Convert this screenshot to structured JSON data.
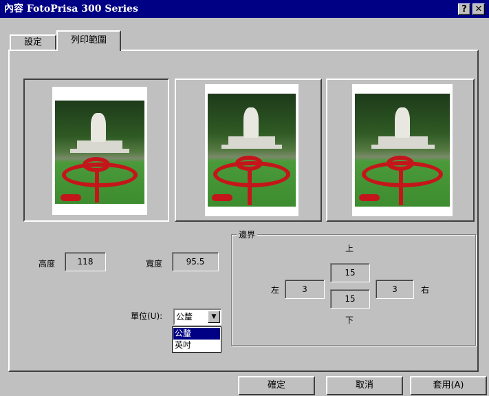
{
  "window": {
    "title": "內容 FotoPrisa 300 Series",
    "help_glyph": "?",
    "close_glyph": "✕"
  },
  "tabs": [
    {
      "label": "設定"
    },
    {
      "label": "列印範圍"
    }
  ],
  "fields": {
    "height_label": "高度",
    "height_value": "118",
    "width_label": "寬度",
    "width_value": "95.5"
  },
  "margins": {
    "group_title": "邊界",
    "top_label": "上",
    "top_value": "15",
    "left_label": "左",
    "left_value": "3",
    "right_label": "右",
    "right_value": "3",
    "bottom_label": "下",
    "bottom_value": "15"
  },
  "unit": {
    "label": "單位(U):",
    "selected": "公釐",
    "options": [
      "公釐",
      "英吋"
    ]
  },
  "buttons": {
    "ok": "確定",
    "cancel": "取消",
    "apply": "套用(A)"
  },
  "colors": {
    "titlebar": "#000084",
    "face": "#c0c0c0",
    "selection": "#000084"
  }
}
